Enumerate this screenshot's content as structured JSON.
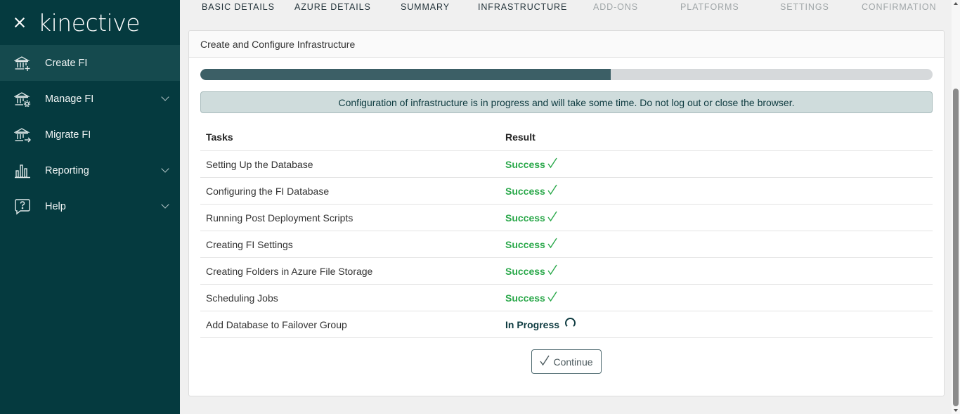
{
  "sidebar": {
    "logo": "kinective",
    "items": [
      {
        "label": "Create FI",
        "icon": "bank-plus-icon"
      },
      {
        "label": "Manage FI",
        "icon": "bank-gear-icon"
      },
      {
        "label": "Migrate FI",
        "icon": "bank-arrow-icon"
      },
      {
        "label": "Reporting",
        "icon": "bar-chart-icon"
      },
      {
        "label": "Help",
        "icon": "help-bubble-icon"
      }
    ]
  },
  "steps": [
    {
      "label": "BASIC DETAILS",
      "state": "done"
    },
    {
      "label": "AZURE DETAILS",
      "state": "done"
    },
    {
      "label": "SUMMARY",
      "state": "done"
    },
    {
      "label": "INFRASTRUCTURE",
      "state": "current"
    },
    {
      "label": "ADD-ONS",
      "state": "future"
    },
    {
      "label": "PLATFORMS",
      "state": "future"
    },
    {
      "label": "SETTINGS",
      "state": "future"
    },
    {
      "label": "CONFIRMATION",
      "state": "future"
    }
  ],
  "card": {
    "title": "Create and Configure Infrastructure",
    "progress": 0.56,
    "alert": "Configuration of infrastructure is in progress and will take some time. Do not log out or close the browser.",
    "table": {
      "headers": [
        "Tasks",
        "Result"
      ],
      "rows": [
        {
          "task": "Setting Up the Database",
          "result": "Success",
          "status": "success"
        },
        {
          "task": "Configuring the FI Database",
          "result": "Success",
          "status": "success"
        },
        {
          "task": "Running Post Deployment Scripts",
          "result": "Success",
          "status": "success"
        },
        {
          "task": "Creating FI Settings",
          "result": "Success",
          "status": "success"
        },
        {
          "task": "Creating Folders in Azure File Storage",
          "result": "Success",
          "status": "success"
        },
        {
          "task": "Scheduling Jobs",
          "result": "Success",
          "status": "success"
        },
        {
          "task": "Add Database to Failover Group",
          "result": "In Progress",
          "status": "in-progress"
        }
      ]
    },
    "continue_label": "Continue"
  },
  "colors": {
    "sidebar_bg": "#053a3f",
    "success": "#2aa84a",
    "progress_fill": "#3c5f66"
  }
}
